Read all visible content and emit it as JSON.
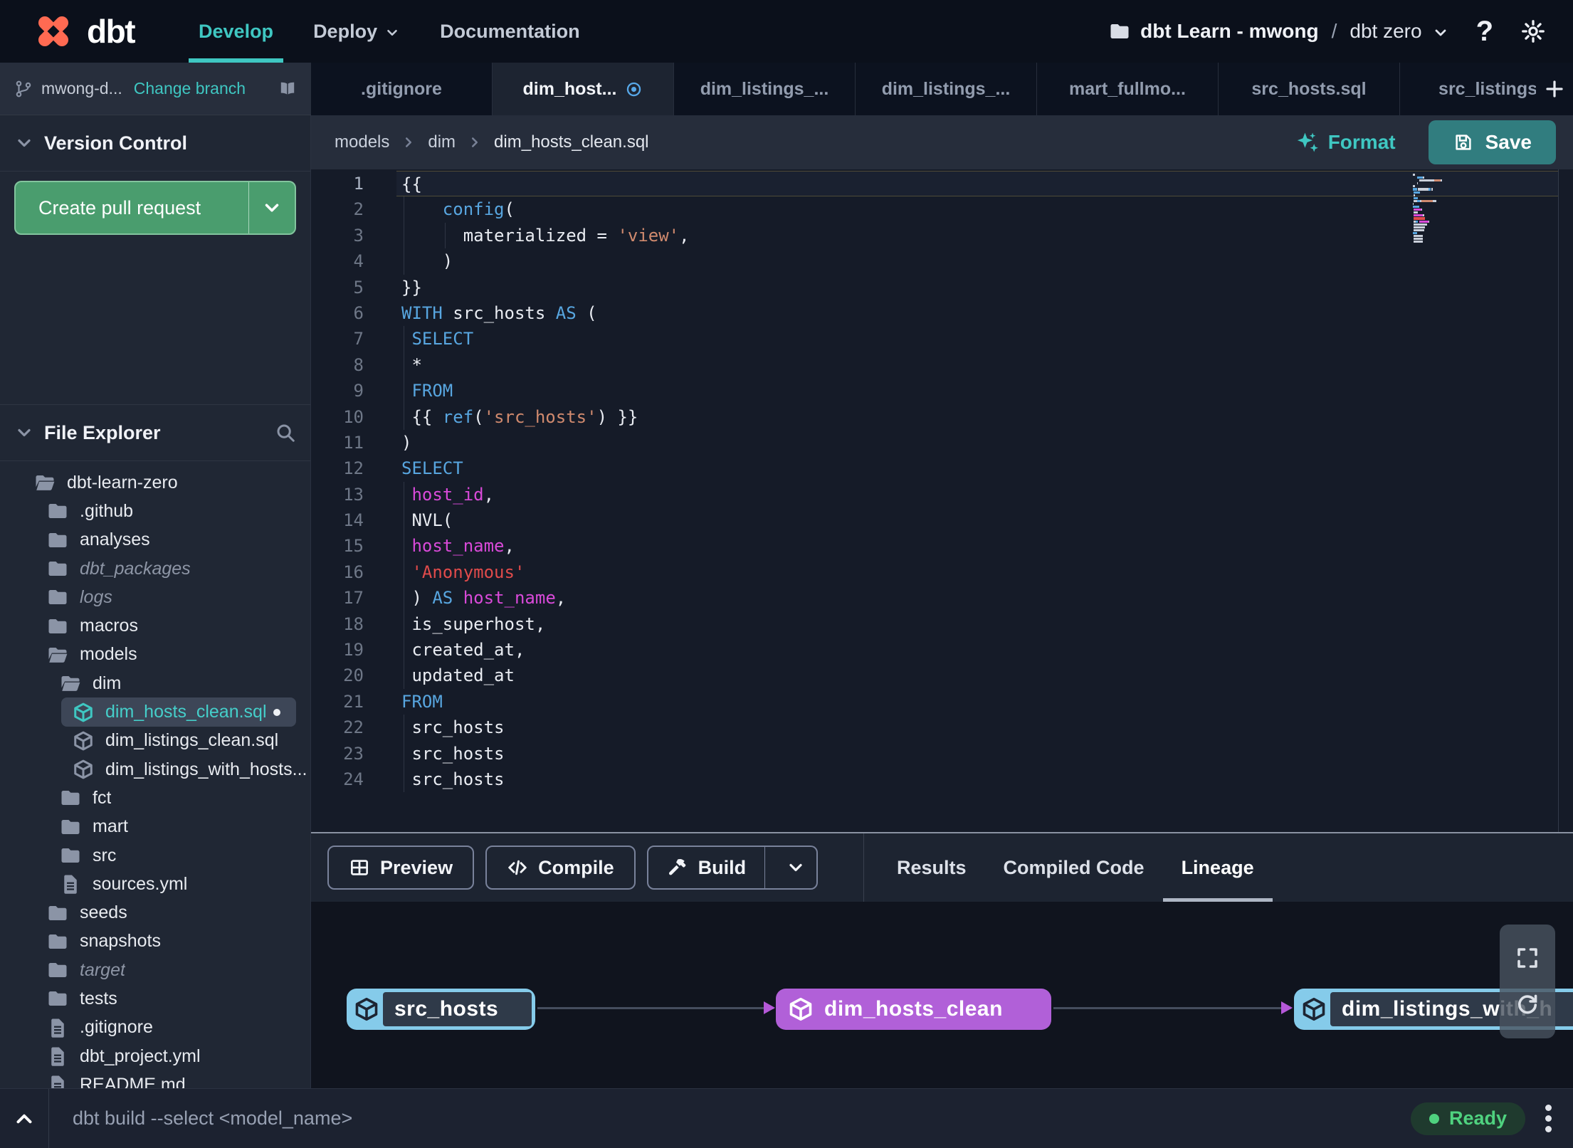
{
  "navbar": {
    "logo_text": "dbt",
    "items": [
      {
        "label": "Develop",
        "active": true
      },
      {
        "label": "Deploy",
        "chevron": true
      },
      {
        "label": "Documentation"
      }
    ],
    "project": "dbt Learn - mwong",
    "separator": "/",
    "environment": "dbt zero",
    "help": "?"
  },
  "branch_bar": {
    "branch": "mwong-d...",
    "action": "Change branch"
  },
  "version_control": {
    "title": "Version Control",
    "create_pr": "Create pull request"
  },
  "file_explorer": {
    "title": "File Explorer",
    "tree": [
      {
        "name": "dbt-learn-zero",
        "depth": 0,
        "icon": "folder-open"
      },
      {
        "name": ".github",
        "depth": 1,
        "icon": "folder"
      },
      {
        "name": "analyses",
        "depth": 1,
        "icon": "folder"
      },
      {
        "name": "dbt_packages",
        "depth": 1,
        "icon": "folder",
        "italic": true
      },
      {
        "name": "logs",
        "depth": 1,
        "icon": "folder",
        "italic": true
      },
      {
        "name": "macros",
        "depth": 1,
        "icon": "folder"
      },
      {
        "name": "models",
        "depth": 1,
        "icon": "folder-open"
      },
      {
        "name": "dim",
        "depth": 2,
        "icon": "folder-open"
      },
      {
        "name": "dim_hosts_clean.sql",
        "depth": 3,
        "icon": "model",
        "selected": true,
        "modified": true
      },
      {
        "name": "dim_listings_clean.sql",
        "depth": 3,
        "icon": "model"
      },
      {
        "name": "dim_listings_with_hosts...",
        "depth": 3,
        "icon": "model"
      },
      {
        "name": "fct",
        "depth": 2,
        "icon": "folder"
      },
      {
        "name": "mart",
        "depth": 2,
        "icon": "folder"
      },
      {
        "name": "src",
        "depth": 2,
        "icon": "folder"
      },
      {
        "name": "sources.yml",
        "depth": 2,
        "icon": "file"
      },
      {
        "name": "seeds",
        "depth": 1,
        "icon": "folder"
      },
      {
        "name": "snapshots",
        "depth": 1,
        "icon": "folder"
      },
      {
        "name": "target",
        "depth": 1,
        "icon": "folder",
        "italic": true
      },
      {
        "name": "tests",
        "depth": 1,
        "icon": "folder"
      },
      {
        "name": ".gitignore",
        "depth": 1,
        "icon": "file"
      },
      {
        "name": "dbt_project.yml",
        "depth": 1,
        "icon": "file"
      },
      {
        "name": "README.md",
        "depth": 1,
        "icon": "file"
      }
    ]
  },
  "tabs": {
    "items": [
      {
        "label": ".gitignore"
      },
      {
        "label": "dim_host...",
        "active": true,
        "modified": true
      },
      {
        "label": "dim_listings_..."
      },
      {
        "label": "dim_listings_..."
      },
      {
        "label": "mart_fullmo..."
      },
      {
        "label": "src_hosts.sql"
      },
      {
        "label": "src_listings."
      }
    ],
    "add": "+"
  },
  "breadcrumb": [
    "models",
    "dim",
    "dim_hosts_clean.sql"
  ],
  "editor_actions": {
    "format": "Format",
    "save": "Save"
  },
  "editor": {
    "lines": [
      {
        "tokens": [
          [
            "p",
            "{{"
          ]
        ],
        "current": true
      },
      {
        "tokens": [
          [
            "p",
            "    "
          ],
          [
            "k",
            "config"
          ],
          [
            "p",
            "("
          ]
        ],
        "guides": [
          0
        ]
      },
      {
        "tokens": [
          [
            "p",
            "      materialized = "
          ],
          [
            "s",
            "'view'"
          ],
          [
            "p",
            ","
          ]
        ],
        "guides": [
          0,
          4
        ]
      },
      {
        "tokens": [
          [
            "p",
            "    )"
          ]
        ],
        "guides": [
          0
        ]
      },
      {
        "tokens": [
          [
            "p",
            "}}"
          ]
        ]
      },
      {
        "tokens": [
          [
            "k",
            "WITH"
          ],
          [
            "p",
            " src_hosts "
          ],
          [
            "k",
            "AS"
          ],
          [
            "p",
            " ("
          ]
        ]
      },
      {
        "tokens": [
          [
            "p",
            " "
          ],
          [
            "k",
            "SELECT"
          ]
        ],
        "guides": [
          0
        ]
      },
      {
        "tokens": [
          [
            "p",
            " *"
          ]
        ],
        "guides": [
          0
        ]
      },
      {
        "tokens": [
          [
            "p",
            " "
          ],
          [
            "k",
            "FROM"
          ]
        ],
        "guides": [
          0
        ]
      },
      {
        "tokens": [
          [
            "p",
            " {{ "
          ],
          [
            "k",
            "ref"
          ],
          [
            "p",
            "("
          ],
          [
            "s",
            "'src_hosts'"
          ],
          [
            "p",
            ") }}"
          ]
        ],
        "guides": [
          0
        ]
      },
      {
        "tokens": [
          [
            "p",
            ")"
          ]
        ]
      },
      {
        "tokens": [
          [
            "k",
            "SELECT"
          ]
        ]
      },
      {
        "tokens": [
          [
            "p",
            " "
          ],
          [
            "m",
            "host_id"
          ],
          [
            "p",
            ","
          ]
        ],
        "guides": [
          0
        ]
      },
      {
        "tokens": [
          [
            "p",
            " NVL("
          ]
        ],
        "guides": [
          0
        ]
      },
      {
        "tokens": [
          [
            "p",
            " "
          ],
          [
            "m",
            "host_name"
          ],
          [
            "p",
            ","
          ]
        ],
        "guides": [
          0
        ]
      },
      {
        "tokens": [
          [
            "p",
            " "
          ],
          [
            "r",
            "'Anonymous'"
          ]
        ],
        "guides": [
          0
        ]
      },
      {
        "tokens": [
          [
            "p",
            " ) "
          ],
          [
            "k",
            "AS"
          ],
          [
            "p",
            " "
          ],
          [
            "m",
            "host_name"
          ],
          [
            "p",
            ","
          ]
        ],
        "guides": [
          0
        ]
      },
      {
        "tokens": [
          [
            "p",
            " is_superhost,"
          ]
        ],
        "guides": [
          0
        ]
      },
      {
        "tokens": [
          [
            "p",
            " created_at,"
          ]
        ],
        "guides": [
          0
        ]
      },
      {
        "tokens": [
          [
            "p",
            " updated_at"
          ]
        ],
        "guides": [
          0
        ]
      },
      {
        "tokens": [
          [
            "k",
            "FROM"
          ]
        ]
      },
      {
        "tokens": [
          [
            "p",
            " src_hosts"
          ]
        ],
        "guides": [
          0
        ]
      },
      {
        "tokens": [
          [
            "p",
            " src_hosts"
          ]
        ],
        "guides": [
          0
        ]
      },
      {
        "tokens": [
          [
            "p",
            " src_hosts"
          ]
        ],
        "guides": [
          0
        ]
      }
    ]
  },
  "toolbar": {
    "preview": "Preview",
    "compile": "Compile",
    "build": "Build"
  },
  "panel_tabs": [
    {
      "label": "Results"
    },
    {
      "label": "Compiled Code"
    },
    {
      "label": "Lineage",
      "active": true
    }
  ],
  "lineage": {
    "nodes": [
      {
        "label": "src_hosts",
        "variant": "cyan"
      },
      {
        "label": "dim_hosts_clean",
        "variant": "purple"
      },
      {
        "label": "dim_listings_with_h",
        "variant": "cyan"
      }
    ]
  },
  "command_bar": {
    "placeholder": "dbt build --select <model_name>",
    "status": "Ready"
  },
  "icons": {
    "logo": "dbt-pinwheel",
    "help": "question-mark",
    "settings": "gear",
    "project": "folder",
    "branch": "git-branch",
    "docs": "open-book",
    "search": "magnifier",
    "modified_tab": "circle-dot",
    "format": "sparkles",
    "save": "floppy-disk",
    "preview": "grid-table",
    "compile": "code-brackets",
    "build": "hammer",
    "lineage_expand": "fullscreen",
    "lineage_refresh": "refresh",
    "model": "cube"
  },
  "colors": {
    "accent_teal": "#3FC7C2",
    "logo_orange": "#FF6A52",
    "pr_green": "#4A9D6E",
    "save_teal": "#317D7F",
    "status_green": "#4FD27F",
    "node_purple": "#B160D8",
    "node_cyan": "#85CBEA",
    "modified_blue": "#57A8E8",
    "syntax_keyword": "#58A6E0",
    "syntax_string": "#D08A6E",
    "syntax_string_alt": "#E14B4B",
    "syntax_column": "#D94AD9"
  }
}
